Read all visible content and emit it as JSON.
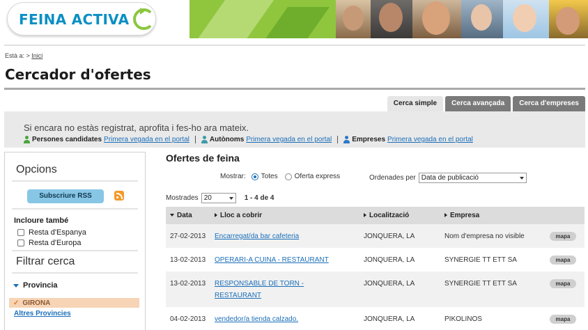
{
  "brand": {
    "logo_text": "FEINA ACTIVA"
  },
  "breadcrumb": {
    "prefix": "Està a: >",
    "link": "Inici"
  },
  "page": {
    "title": "Cercador d'ofertes"
  },
  "tabs": [
    {
      "label": "Cerca simple",
      "active": true
    },
    {
      "label": "Cerca avançada",
      "active": false
    },
    {
      "label": "Cerca d'empreses",
      "active": false
    }
  ],
  "info": {
    "message": "Si encara no estàs registrat, aprofita i fes-ho ara mateix.",
    "links": [
      {
        "label": "Persones candidates",
        "link": "Primera vegada en el portal"
      },
      {
        "label": "Autònoms",
        "link": "Primera vegada en el portal"
      },
      {
        "label": "Empreses",
        "link": "Primera vegada en el portal"
      }
    ]
  },
  "sidebar": {
    "options_title": "Opcions",
    "rss_button": "Subscriure RSS",
    "include_title": "Incloure també",
    "include_options": [
      "Resta d'Espanya",
      "Resta d'Europa"
    ],
    "filter_title": "Filtrar cerca",
    "province_title": "Provincia",
    "selected_province": "GIRONA",
    "other_provinces": "Altres Provincies"
  },
  "results": {
    "title": "Ofertes de feina",
    "show_label": "Mostrar:",
    "show_options": [
      "Totes",
      "Oferta express"
    ],
    "show_selected": "Totes",
    "order_label": "Ordenades per",
    "order_value": "Data de publicació",
    "shown_label": "Mostrades",
    "shown_value": "20",
    "range": "1 - 4 de 4",
    "columns": [
      "Data",
      "Lloc a cobrir",
      "Localització",
      "Empresa"
    ],
    "map_label": "mapa",
    "rows": [
      {
        "date": "27-02-2013",
        "position": "Encarregat/da bar cafeteria",
        "location": "JONQUERA, LA",
        "company": "Nom d'empresa no visible"
      },
      {
        "date": "13-02-2013",
        "position": "OPERARI-A CUINA - RESTAURANT",
        "location": "JONQUERA, LA",
        "company": "SYNERGIE TT ETT SA"
      },
      {
        "date": "13-02-2013",
        "position": "RESPONSABLE DE TORN - RESTAURANT",
        "location": "JONQUERA, LA",
        "company": "SYNERGIE TT ETT SA"
      },
      {
        "date": "04-02-2013",
        "position": "vendedor/a tienda calzado.",
        "location": "JONQUERA, LA",
        "company": "PIKOLINOS"
      }
    ]
  },
  "colors": {
    "brand_blue": "#0b8fc4",
    "brand_green": "#8cc63f",
    "link_blue": "#1b6fb9",
    "tab_gray": "#7a7a7a"
  }
}
